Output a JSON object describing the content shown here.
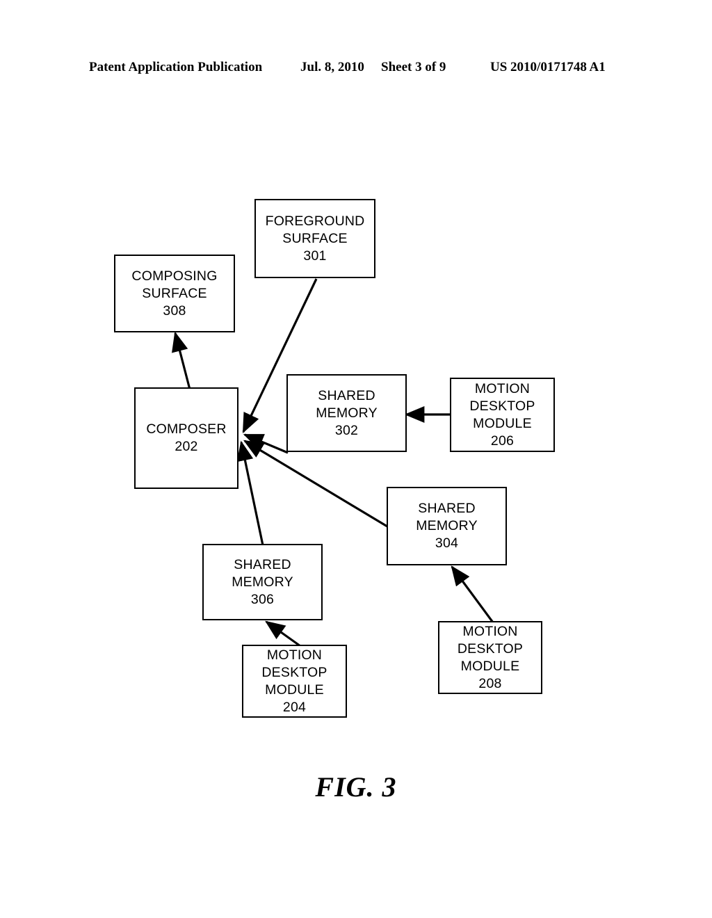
{
  "header": {
    "publication": "Patent Application Publication",
    "date": "Jul. 8, 2010",
    "sheet": "Sheet 3 of 9",
    "patent_number": "US 2010/0171748 A1"
  },
  "figure": {
    "caption": "FIG. 3",
    "type": "block-diagram",
    "stroke_color": "#000000",
    "fill_color": "#ffffff"
  },
  "diagram": {
    "nodes": [
      {
        "id": "301",
        "name": "foreground-surface",
        "lines": [
          "FOREGROUND",
          "SURFACE",
          "301"
        ],
        "line1": "FOREGROUND",
        "line2": "SURFACE",
        "line3": "301"
      },
      {
        "id": "308",
        "name": "composing-surface",
        "lines": [
          "COMPOSING",
          "SURFACE",
          "308"
        ],
        "line1": "COMPOSING",
        "line2": "SURFACE",
        "line3": "308"
      },
      {
        "id": "202",
        "name": "composer",
        "lines": [
          "COMPOSER",
          "202"
        ],
        "line1": "COMPOSER",
        "line2": "202",
        "line3": ""
      },
      {
        "id": "302",
        "name": "shared-memory-302",
        "lines": [
          "SHARED",
          "MEMORY",
          "302"
        ],
        "line1": "SHARED",
        "line2": "MEMORY",
        "line3": "302"
      },
      {
        "id": "206",
        "name": "motion-desktop-module-206",
        "lines": [
          "MOTION",
          "DESKTOP",
          "MODULE",
          "206"
        ],
        "line1": "MOTION",
        "line2": "DESKTOP",
        "line3": "MODULE",
        "line4": "206"
      },
      {
        "id": "304",
        "name": "shared-memory-304",
        "lines": [
          "SHARED",
          "MEMORY",
          "304"
        ],
        "line1": "SHARED",
        "line2": "MEMORY",
        "line3": "304"
      },
      {
        "id": "306",
        "name": "shared-memory-306",
        "lines": [
          "SHARED",
          "MEMORY",
          "306"
        ],
        "line1": "SHARED",
        "line2": "MEMORY",
        "line3": "306"
      },
      {
        "id": "204",
        "name": "motion-desktop-module-204",
        "lines": [
          "MOTION",
          "DESKTOP",
          "MODULE",
          "204"
        ],
        "line1": "MOTION",
        "line2": "DESKTOP",
        "line3": "MODULE",
        "line4": "204"
      },
      {
        "id": "208",
        "name": "motion-desktop-module-208",
        "lines": [
          "MOTION",
          "DESKTOP",
          "MODULE",
          "208"
        ],
        "line1": "MOTION",
        "line2": "DESKTOP",
        "line3": "MODULE",
        "line4": "208"
      }
    ],
    "edges": [
      {
        "from": "301",
        "to": "202",
        "label": ""
      },
      {
        "from": "202",
        "to": "308",
        "label": ""
      },
      {
        "from": "302",
        "to": "202",
        "label": ""
      },
      {
        "from": "206",
        "to": "302",
        "label": ""
      },
      {
        "from": "304",
        "to": "202",
        "label": ""
      },
      {
        "from": "208",
        "to": "304",
        "label": ""
      },
      {
        "from": "306",
        "to": "202",
        "label": ""
      },
      {
        "from": "204",
        "to": "306",
        "label": ""
      }
    ]
  }
}
